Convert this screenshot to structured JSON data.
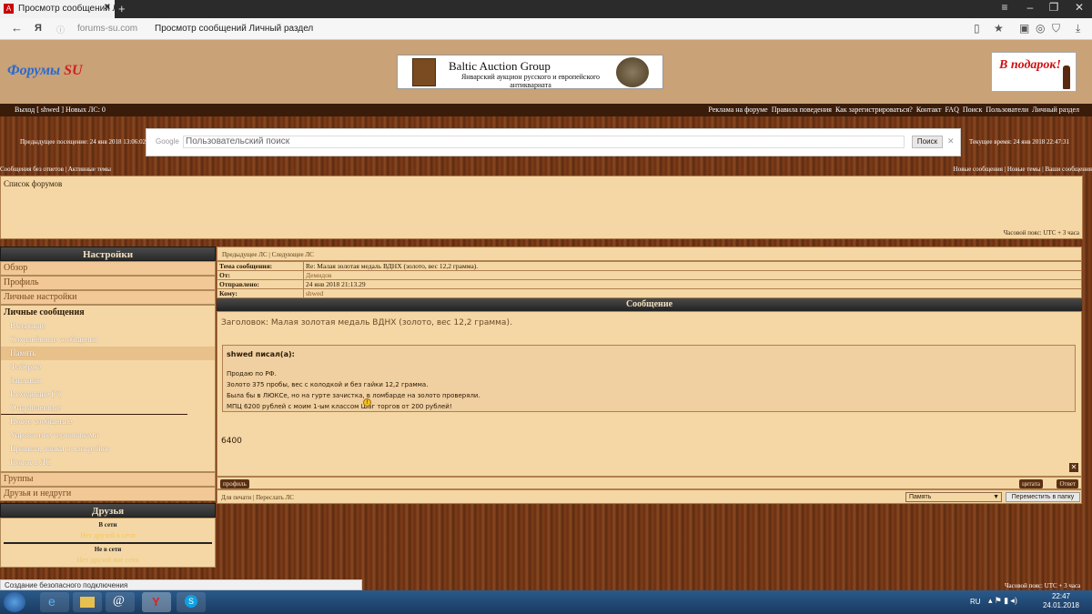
{
  "browser": {
    "tab_title": "Просмотр сообщений Лич",
    "url": "forums-su.com",
    "page_title": "Просмотр сообщений Личный раздел"
  },
  "site": {
    "logo_main": "Форумы",
    "logo_accent": "SU",
    "banner_title": "Baltic Auction Group",
    "banner_subtitle": "Январский аукцион русского и европейского антиквариата",
    "gift_text": "В подарок!"
  },
  "menubar": {
    "left": "Выход [ shwed ]   Новых ЛС: 0",
    "right_items": [
      "Реклама на форуме",
      "Правила поведения",
      "Как зарегистрироваться?",
      "Контакт",
      "FAQ",
      "Поиск",
      "Пользователи",
      "Личный раздел"
    ]
  },
  "search": {
    "prev_visit": "Предыдущее посещение: 24 янв 2018 13:06:02",
    "current_time": "Текущее время: 24 янв 2018 22:47:31",
    "google_label": "Google",
    "placeholder": "Пользовательский поиск",
    "button": "Поиск"
  },
  "links": {
    "left": "Сообщения без ответов  |  Активные темы",
    "right": "Новые сообщения | Новые темы | Ваши сообщения"
  },
  "forum_list": {
    "title": "Список форумов",
    "timezone": "Часовой пояс: UTC + 3 часа"
  },
  "sidebar": {
    "settings_title": "Настройки",
    "items": [
      "Обзор",
      "Профиль",
      "Личные настройки"
    ],
    "pm_title": "Личные сообщения",
    "folders": [
      "Входящие",
      "Сохранённые сообщения",
      "Память",
      "Фаберже",
      "Запасная",
      "Исходящие (7)",
      "Отправленные"
    ],
    "actions": [
      "Новое сообщение",
      "Управление черновиками",
      "Правила, папки и настройки",
      "Поиск в ЛС"
    ],
    "bottom_items": [
      "Группы",
      "Друзья и недруги"
    ],
    "friends_title": "Друзья",
    "online_label": "В сети",
    "online_empty": "Нет друзей в сети",
    "offline_label": "Не в сети",
    "offline_empty": "Нет друзей вне сети"
  },
  "message": {
    "nav": "Предыдущее ЛС  |  Следующее ЛС",
    "fields": [
      {
        "label": "Тема сообщения:",
        "value": "Re: Малая золотая медаль ВДНХ (золото, вес 12,2 грамма)."
      },
      {
        "label": "От:",
        "value": "Демидов"
      },
      {
        "label": "Отправлено:",
        "value": "24 янв 2018 21:13.29"
      },
      {
        "label": "Кому:",
        "value": "shwed"
      }
    ],
    "header": "Сообщение",
    "subject": "Заголовок: Малая золотая медаль ВДНХ (золото, вес 12,2 грамма).",
    "quote_author": "shwed писал(а):",
    "quote_lines": [
      "Продаю по РФ.",
      "Золото 375 пробы, вес с колодкой и без гайки 12,2 грамма.",
      "Была бы в ЛЮКСе, но на гурте зачистка, в ломбарде на золото проверяли.",
      "МПЦ 6200 рублей с моим 1-ым классом  Шаг торгов от 200 рублей!"
    ],
    "reply_text": "6400",
    "profile_btn": "профиль",
    "quote_btn": "цитата",
    "reply_btn": "Ответ",
    "footer_left": "Для печати  |  Переслать ЛС",
    "move_select": "Память",
    "move_btn": "Переместить в папку"
  },
  "statusbar": "Создание безопасного подключения",
  "taskbar": {
    "lang": "RU",
    "time": "22:47",
    "date": "24.01.2018"
  }
}
